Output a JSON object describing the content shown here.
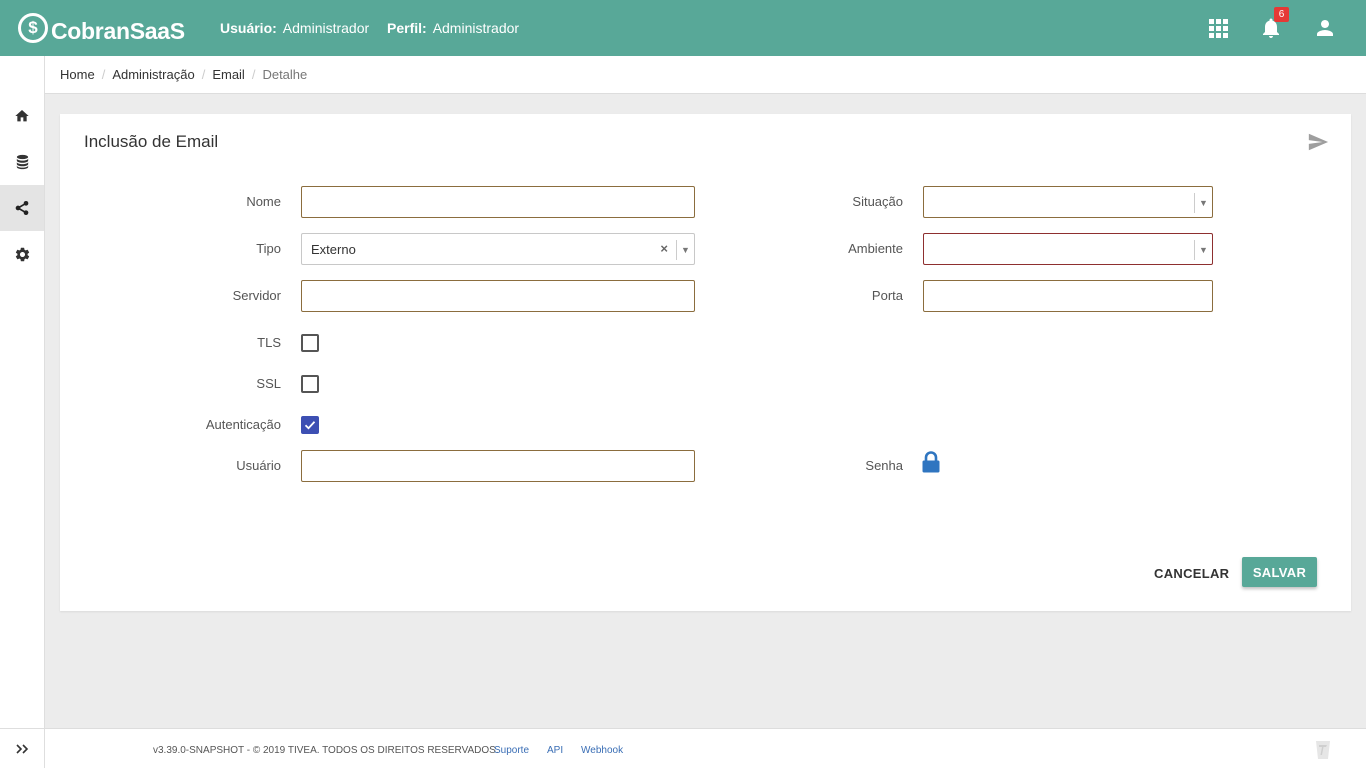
{
  "app": {
    "name": "CobranSaaS",
    "logo_mark": "$"
  },
  "header": {
    "user_label": "Usuário:",
    "user_value": "Administrador",
    "profile_label": "Perfil:",
    "profile_value": "Administrador",
    "notifications_count": "6",
    "icons": [
      "apps-grid-icon",
      "bell-icon",
      "account-icon"
    ]
  },
  "sidebar": {
    "items": [
      {
        "icon": "home-icon",
        "active": false
      },
      {
        "icon": "database-icon",
        "active": false
      },
      {
        "icon": "share-icon",
        "active": true
      },
      {
        "icon": "gear-icon",
        "active": false
      }
    ],
    "expand_label": "»"
  },
  "breadcrumb": [
    "Home",
    "Administração",
    "Email",
    "Detalhe"
  ],
  "form": {
    "title": "Inclusão de Email",
    "nome": {
      "label": "Nome",
      "value": ""
    },
    "tipo": {
      "label": "Tipo",
      "value": "Externo",
      "clear": "×",
      "arrow": "▼"
    },
    "servidor": {
      "label": "Servidor",
      "value": ""
    },
    "tls": {
      "label": "TLS",
      "checked": false
    },
    "ssl": {
      "label": "SSL",
      "checked": false
    },
    "autenticacao": {
      "label": "Autenticação",
      "checked": true
    },
    "usuario": {
      "label": "Usuário",
      "value": ""
    },
    "situacao": {
      "label": "Situação",
      "value": "",
      "arrow": "▼"
    },
    "ambiente": {
      "label": "Ambiente",
      "value": "",
      "arrow": "▼"
    },
    "porta": {
      "label": "Porta",
      "value": ""
    },
    "senha": {
      "label": "Senha"
    }
  },
  "actions": {
    "cancel": "CANCELAR",
    "save": "SALVAR"
  },
  "footer": {
    "copyright": "v3.39.0-SNAPSHOT - © 2019 TIVEA. TODOS OS DIREITOS RESERVADOS.",
    "links": [
      "Suporte",
      "API",
      "Webhook"
    ]
  },
  "colors": {
    "primary": "#58a898",
    "input_border": "#8b6d3e",
    "checkbox": "#3d4fb3",
    "badge": "#e53935",
    "lock": "#2f75c0"
  }
}
